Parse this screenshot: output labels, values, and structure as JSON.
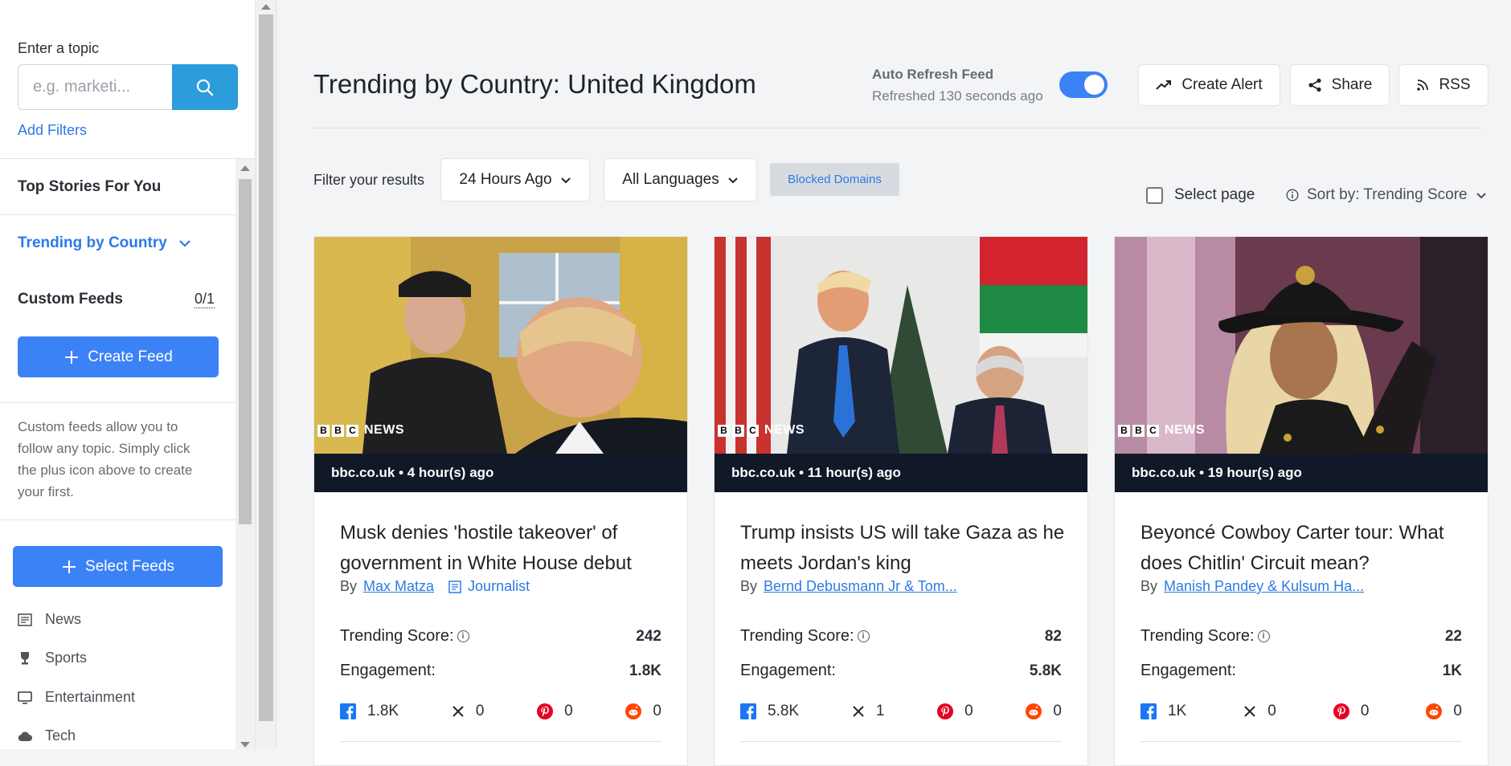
{
  "sidebar": {
    "topic_label": "Enter a topic",
    "search_placeholder": "e.g. marketi...",
    "add_filters": "Add Filters",
    "top_stories": "Top Stories For You",
    "trending_by_country": "Trending by Country",
    "custom_feeds": "Custom Feeds",
    "custom_feeds_count": "0/1",
    "create_feed": "Create Feed",
    "help_text": "Custom feeds allow you to follow any topic. Simply click the plus icon above to create your first.",
    "select_feeds": "Select Feeds",
    "categories": [
      {
        "label": "News",
        "icon": "newspaper-icon"
      },
      {
        "label": "Sports",
        "icon": "trophy-icon"
      },
      {
        "label": "Entertainment",
        "icon": "monitor-icon"
      },
      {
        "label": "Tech",
        "icon": "cloud-icon"
      }
    ]
  },
  "header": {
    "title": "Trending by Country: United Kingdom",
    "auto_refresh_label": "Auto Refresh Feed",
    "refreshed_text": "Refreshed 130 seconds ago",
    "auto_refresh_on": true,
    "create_alert": "Create Alert",
    "share": "Share",
    "rss": "RSS"
  },
  "filters": {
    "label": "Filter your results",
    "time": "24 Hours Ago",
    "language": "All Languages",
    "blocked_domains": "Blocked Domains",
    "select_page": "Select page",
    "sort": "Sort by: Trending Score"
  },
  "cards": [
    {
      "meta": "bbc.co.uk • 4 hour(s) ago",
      "title": "Musk denies 'hostile takeover' of government in White House debut",
      "by": "By",
      "author": "Max Matza",
      "role": "Journalist",
      "trending_label": "Trending Score:",
      "trending_score": "242",
      "engagement_label": "Engagement:",
      "engagement": "1.8K",
      "facebook": "1.8K",
      "x": "0",
      "pinterest": "0",
      "reddit": "0"
    },
    {
      "meta": "bbc.co.uk • 11 hour(s) ago",
      "title": "Trump insists US will take Gaza as he meets Jordan's king",
      "by": "By",
      "author": "Bernd Debusmann Jr & Tom...",
      "role": "",
      "trending_label": "Trending Score:",
      "trending_score": "82",
      "engagement_label": "Engagement:",
      "engagement": "5.8K",
      "facebook": "5.8K",
      "x": "1",
      "pinterest": "0",
      "reddit": "0"
    },
    {
      "meta": "bbc.co.uk • 19 hour(s) ago",
      "title": "Beyoncé Cowboy Carter tour: What does Chitlin' Circuit mean?",
      "by": "By",
      "author": "Manish Pandey & Kulsum Ha...",
      "role": "",
      "trending_label": "Trending Score:",
      "trending_score": "22",
      "engagement_label": "Engagement:",
      "engagement": "1K",
      "facebook": "1K",
      "x": "0",
      "pinterest": "0",
      "reddit": "0"
    }
  ],
  "brand": {
    "bbc_letters": [
      "B",
      "B",
      "C"
    ],
    "bbc_news": "NEWS"
  },
  "colors": {
    "accent": "#3b82f6",
    "search_button": "#2c9cdb",
    "link": "#2c7be5",
    "card_meta_bg": "#111827",
    "facebook": "#1877f2",
    "pinterest": "#e60023",
    "reddit": "#ff4500"
  }
}
